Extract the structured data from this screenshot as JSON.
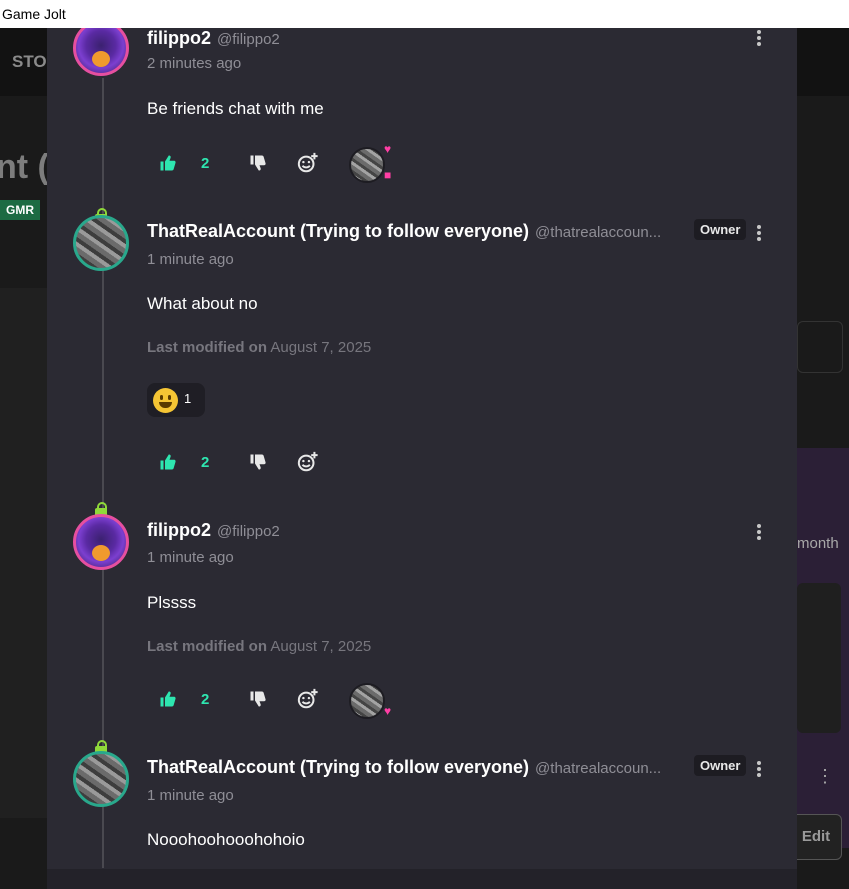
{
  "window": {
    "title": "Game Jolt"
  },
  "background": {
    "nav_fragment": "STO",
    "title_fragment": "nt (",
    "badge": "GMR",
    "side_text": "month",
    "edit_button": "Edit"
  },
  "colors": {
    "accent": "#2ee6b0",
    "owner_badge_bg": "#1d1c22",
    "modal_bg": "#2b2a33",
    "heart": "#ff3ea5"
  },
  "comments": [
    {
      "name": "filippo2",
      "handle": "@filippo2",
      "time": "2 minutes ago",
      "text": "Be friends chat with me",
      "likes": "2",
      "avatar_icon": "purple-monster-avatar"
    },
    {
      "name": "ThatRealAccount (Trying to follow everyone)",
      "handle": "@thatrealaccoun...",
      "owner": "Owner",
      "time": "1 minute ago",
      "text": "What about no",
      "modified_label": "Last modified on",
      "modified_date": "August 7, 2025",
      "reaction_emoji": "grinning-face-icon",
      "reaction_count": "1",
      "likes": "2",
      "avatar_icon": "city-photo-avatar"
    },
    {
      "name": "filippo2",
      "handle": "@filippo2",
      "time": "1 minute ago",
      "text": "Plssss",
      "modified_label": "Last modified on",
      "modified_date": "August 7, 2025",
      "likes": "2",
      "avatar_icon": "purple-monster-avatar"
    },
    {
      "name": "ThatRealAccount (Trying to follow everyone)",
      "handle": "@thatrealaccoun...",
      "owner": "Owner",
      "time": "1 minute ago",
      "text": "Nooohoohooohohoio",
      "avatar_icon": "city-photo-avatar"
    }
  ]
}
